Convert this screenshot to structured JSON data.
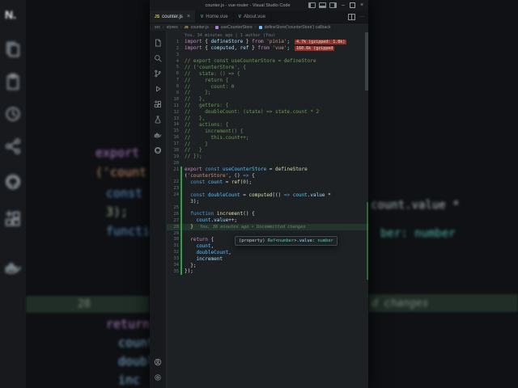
{
  "window": {
    "title": "counter.js - vue-router - Visual Studio Code",
    "controls": [
      "minimize",
      "maximize",
      "close"
    ]
  },
  "glyphs": {
    "close": "×",
    "minimize": "–",
    "more": "···",
    "crumb_sep": "›"
  },
  "tabs": [
    {
      "icon": "JS",
      "label": "counter.js",
      "active": true
    },
    {
      "icon": "V",
      "label": "Home.vue",
      "active": false
    },
    {
      "icon": "V",
      "label": "About.vue",
      "active": false
    }
  ],
  "breadcrumb": {
    "file_icon": "JS",
    "items": [
      "src",
      "stores",
      "counter.js",
      "useCounterStore",
      "defineStore('counterStore') callback"
    ]
  },
  "activity_bar": {
    "top": [
      "explorer",
      "search",
      "source-control",
      "run-and-debug",
      "extensions",
      "testing",
      "docker",
      "github"
    ],
    "bottom": [
      "account",
      "settings"
    ]
  },
  "editor": {
    "rows": [
      {
        "n": "",
        "cls": "lens",
        "tokens": [
          [
            "You, 34 minutes ago | 1 author (You)",
            "lens"
          ]
        ]
      },
      {
        "n": "1",
        "tokens": [
          [
            "import",
            "kw"
          ],
          [
            " { ",
            "pl"
          ],
          [
            "defineStore",
            "var"
          ],
          [
            " } ",
            "pl"
          ],
          [
            "from",
            "kw"
          ],
          [
            " ",
            "pl"
          ],
          [
            "'pinia'",
            "str"
          ],
          [
            ";",
            "pl"
          ]
        ],
        "badge": "4.7k (gzipped: 1.8k)"
      },
      {
        "n": "2",
        "tokens": [
          [
            "import",
            "kw"
          ],
          [
            " { ",
            "pl"
          ],
          [
            "computed",
            "var"
          ],
          [
            ", ",
            "pl"
          ],
          [
            "ref",
            "var"
          ],
          [
            " } ",
            "pl"
          ],
          [
            "from",
            "kw"
          ],
          [
            " ",
            "pl"
          ],
          [
            "'vue'",
            "str"
          ],
          [
            ";",
            "pl"
          ]
        ],
        "badge": "160.6k (gzipped"
      },
      {
        "n": "3",
        "tokens": []
      },
      {
        "n": "4",
        "tokens": [
          [
            "// export const useCounterStore = defineStore",
            "cm"
          ]
        ]
      },
      {
        "n": "5",
        "tokens": [
          [
            "// ('counterStore', {",
            "cm"
          ]
        ]
      },
      {
        "n": "6",
        "tokens": [
          [
            "//   state: () => {",
            "cm"
          ]
        ]
      },
      {
        "n": "7",
        "tokens": [
          [
            "//     return {",
            "cm"
          ]
        ]
      },
      {
        "n": "8",
        "tokens": [
          [
            "//       count: 0",
            "cm"
          ]
        ]
      },
      {
        "n": "9",
        "tokens": [
          [
            "//     };",
            "cm"
          ]
        ]
      },
      {
        "n": "10",
        "tokens": [
          [
            "//   },",
            "cm"
          ]
        ]
      },
      {
        "n": "11",
        "tokens": [
          [
            "//   getters: {",
            "cm"
          ]
        ]
      },
      {
        "n": "12",
        "tokens": [
          [
            "//     doubleCount: (state) => state.count * 2",
            "cm"
          ]
        ]
      },
      {
        "n": "13",
        "tokens": [
          [
            "//   },",
            "cm"
          ]
        ]
      },
      {
        "n": "14",
        "tokens": [
          [
            "//   actions: {",
            "cm"
          ]
        ]
      },
      {
        "n": "15",
        "tokens": [
          [
            "//     increment() {",
            "cm"
          ]
        ]
      },
      {
        "n": "16",
        "tokens": [
          [
            "//       this.count++;",
            "cm"
          ]
        ]
      },
      {
        "n": "17",
        "tokens": [
          [
            "//     }",
            "cm"
          ]
        ]
      },
      {
        "n": "18",
        "tokens": [
          [
            "//   }",
            "cm"
          ]
        ]
      },
      {
        "n": "19",
        "tokens": [
          [
            "// });",
            "cm"
          ]
        ]
      },
      {
        "n": "20",
        "tokens": []
      },
      {
        "n": "21",
        "mod": true,
        "tokens": [
          [
            "export",
            "kw"
          ],
          [
            " ",
            "pl"
          ],
          [
            "const",
            "decl"
          ],
          [
            " ",
            "pl"
          ],
          [
            "useCounterStore",
            "cnst"
          ],
          [
            " = ",
            "pl"
          ],
          [
            "defineStore",
            "fn"
          ]
        ]
      },
      {
        "n": "",
        "mod": true,
        "tokens": [
          [
            "(",
            "pl"
          ],
          [
            "'counterStore'",
            "str"
          ],
          [
            ", () ",
            "pl"
          ],
          [
            "=>",
            "decl"
          ],
          [
            " {",
            "pl"
          ]
        ]
      },
      {
        "n": "22",
        "mod": true,
        "tokens": [
          [
            "  ",
            "pl"
          ],
          [
            "const",
            "decl"
          ],
          [
            " ",
            "pl"
          ],
          [
            "count",
            "cnst"
          ],
          [
            " = ",
            "pl"
          ],
          [
            "ref",
            "fn"
          ],
          [
            "(",
            "pl"
          ],
          [
            "0",
            "num"
          ],
          [
            ");",
            "pl"
          ]
        ]
      },
      {
        "n": "23",
        "mod": true,
        "tokens": []
      },
      {
        "n": "24",
        "mod": true,
        "tokens": [
          [
            "  ",
            "pl"
          ],
          [
            "const",
            "decl"
          ],
          [
            " ",
            "pl"
          ],
          [
            "doubleCount",
            "cnst"
          ],
          [
            " = ",
            "pl"
          ],
          [
            "computed",
            "fn"
          ],
          [
            "(() ",
            "pl"
          ],
          [
            "=>",
            "decl"
          ],
          [
            " ",
            "pl"
          ],
          [
            "count",
            "cnst"
          ],
          [
            ".",
            "pl"
          ],
          [
            "value",
            "var"
          ],
          [
            " *",
            "pl"
          ]
        ]
      },
      {
        "n": "",
        "mod": true,
        "tokens": [
          [
            "  ",
            "pl"
          ],
          [
            "3",
            "num"
          ],
          [
            ");",
            "pl"
          ]
        ]
      },
      {
        "n": "25",
        "mod": true,
        "tokens": []
      },
      {
        "n": "26",
        "mod": true,
        "tokens": [
          [
            "  ",
            "pl"
          ],
          [
            "function",
            "decl"
          ],
          [
            " ",
            "pl"
          ],
          [
            "increment",
            "fn"
          ],
          [
            "() {",
            "pl"
          ]
        ]
      },
      {
        "n": "27",
        "mod": true,
        "tokens": [
          [
            "    ",
            "pl"
          ],
          [
            "count",
            "cnst"
          ],
          [
            ".",
            "pl"
          ],
          [
            "value",
            "var"
          ],
          [
            "++;",
            "pl"
          ]
        ]
      },
      {
        "n": "28",
        "mod": true,
        "hl": true,
        "tokens": [
          [
            "  }",
            "pl"
          ]
        ],
        "blame": "You, 36 minutes ago • Uncommitted changes"
      },
      {
        "n": "29",
        "mod": true,
        "tokens": []
      },
      {
        "n": "30",
        "mod": true,
        "tokens": [
          [
            "  ",
            "pl"
          ],
          [
            "return",
            "kw"
          ],
          [
            " {",
            "pl"
          ]
        ]
      },
      {
        "n": "31",
        "mod": true,
        "tokens": [
          [
            "    ",
            "pl"
          ],
          [
            "count",
            "cnst"
          ],
          [
            ",",
            "pl"
          ]
        ]
      },
      {
        "n": "32",
        "mod": true,
        "tokens": [
          [
            "    ",
            "pl"
          ],
          [
            "doubleCount",
            "cnst"
          ],
          [
            ",",
            "pl"
          ]
        ]
      },
      {
        "n": "33",
        "mod": true,
        "tokens": [
          [
            "    ",
            "pl"
          ],
          [
            "increment",
            "var"
          ]
        ]
      },
      {
        "n": "34",
        "mod": true,
        "tokens": [
          [
            "  };",
            "pl"
          ]
        ]
      },
      {
        "n": "35",
        "mod": true,
        "tokens": [
          [
            "});",
            "pl"
          ]
        ]
      }
    ],
    "tooltip": [
      [
        "(property) ",
        "ttpl"
      ],
      [
        "Ref",
        "tttype"
      ],
      [
        "<",
        "ttpl"
      ],
      [
        "number",
        "tttype"
      ],
      [
        ">.",
        "ttpl"
      ],
      [
        "value",
        "ttvar"
      ],
      [
        ": ",
        "ttpl"
      ],
      [
        "number",
        "tttype"
      ]
    ]
  },
  "bg": {
    "logo": "N.",
    "icons": [
      "files",
      "clipboard",
      "history",
      "share",
      "github",
      "extensions",
      "docker"
    ],
    "left_fragments": [
      "export",
      "('count",
      "const",
      "3);",
      "function",
      "28",
      "return",
      "count,",
      "double",
      "inc"
    ],
    "right_fragments": [
      "count.value *",
      "ber: number",
      "d changes"
    ]
  }
}
